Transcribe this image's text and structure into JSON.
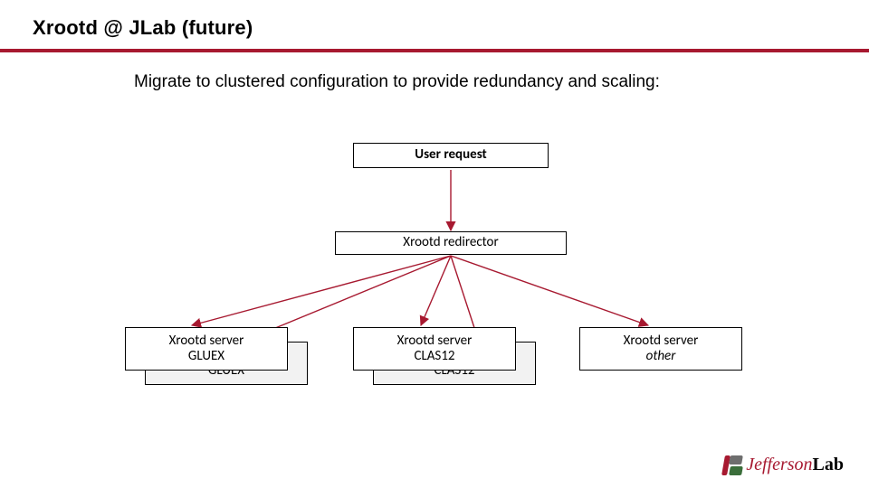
{
  "slide": {
    "title": "Xrootd @ JLab (future)",
    "subtitle": "Migrate to clustered configuration to provide redundancy and scaling:"
  },
  "diagram": {
    "user_request": "User request",
    "redirector": "Xrootd redirector",
    "server_label": "Xrootd server",
    "groups": {
      "gluex": "GLUEX",
      "clas12": "CLAS12",
      "other": "other"
    }
  },
  "logo": {
    "jeff": "Jefferson",
    "lab": "Lab"
  },
  "colors": {
    "accent": "#a71930"
  }
}
